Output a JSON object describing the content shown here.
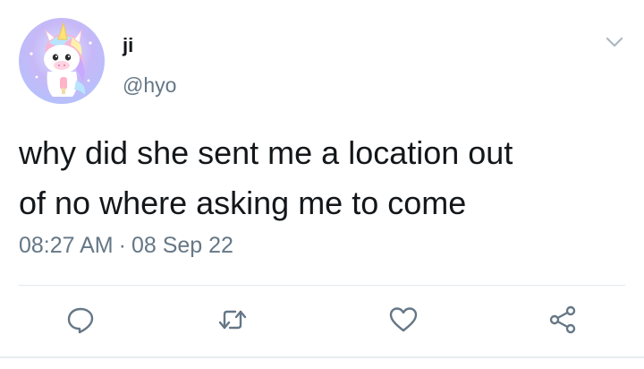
{
  "author": {
    "display_name": "ji",
    "handle": "@hyo",
    "avatar_icon": "unicorn-avatar"
  },
  "tweet": {
    "text_lines": [
      "why did she sent me a location out",
      "of no where asking me to come"
    ],
    "time": "08:27 AM",
    "separator": "·",
    "date": "08 Sep 22"
  },
  "actions": {
    "reply_icon": "reply-icon",
    "retweet_icon": "retweet-icon",
    "like_icon": "heart-icon",
    "share_icon": "share-icon"
  },
  "colors": {
    "text": "#14171a",
    "secondary": "#657786",
    "icon": "#657786",
    "divider": "#e1e8ed"
  }
}
